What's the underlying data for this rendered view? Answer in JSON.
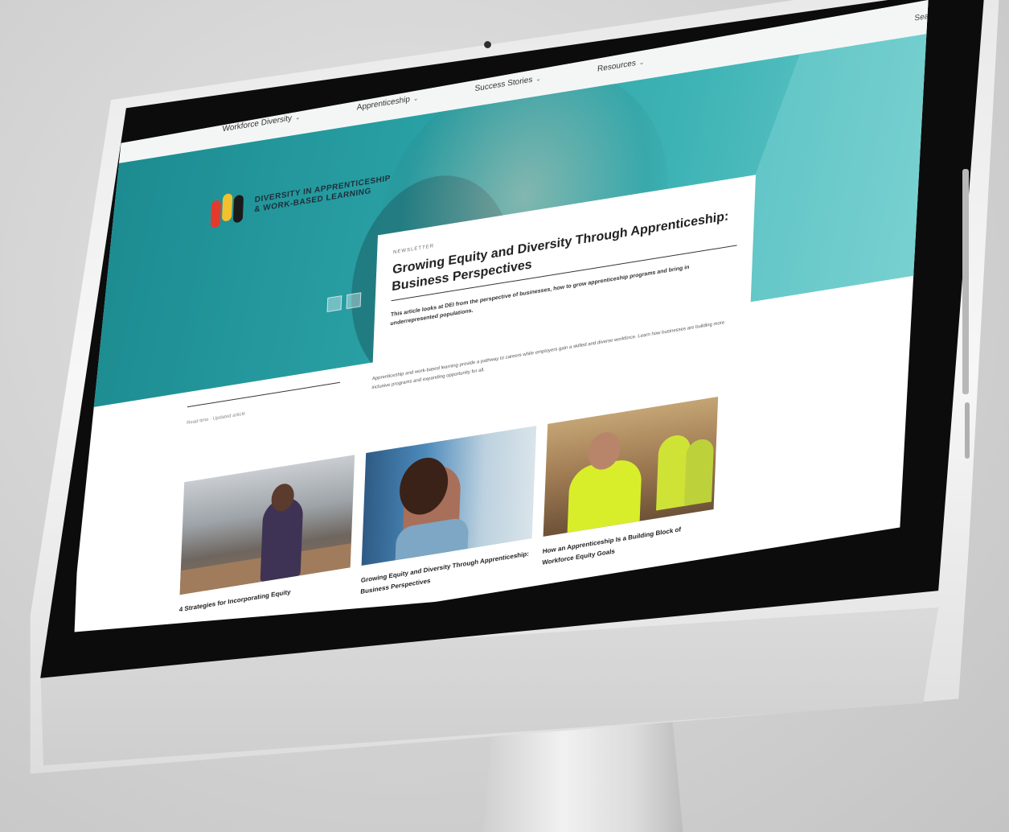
{
  "nav": {
    "items": [
      {
        "label": "Workforce Diversity",
        "icon": "chevron-down-icon"
      },
      {
        "label": "Apprenticeship",
        "icon": "chevron-down-icon"
      },
      {
        "label": "Success Stories",
        "icon": "chevron-down-icon"
      },
      {
        "label": "Resources",
        "icon": "chevron-down-icon"
      }
    ],
    "search_label": "Search Site",
    "search_icon": "search-icon"
  },
  "logo": {
    "line1": "Diversity in Apprenticeship",
    "line2": "& Work-Based Learning"
  },
  "feature": {
    "kicker": "Newsletter",
    "title": "Growing Equity and Diversity Through Apprenticeship: Business Perspectives",
    "summary": "This article looks at DEI from the perspective of businesses, how to grow apprenticeship programs and bring in underrepresented populations."
  },
  "body": {
    "meta": "Read time · Updated article",
    "paragraph": "Apprenticeship and work-based learning provide a pathway to careers while employers gain a skilled and diverse workforce. Learn how businesses are building more inclusive programs and expanding opportunity for all."
  },
  "cards": [
    {
      "caption": "4 Strategies for Incorporating Equity",
      "image": "woman-office-laptop-photo"
    },
    {
      "caption": "Growing Equity and Diversity Through Apprenticeship: Business Perspectives",
      "image": "woman-portrait-photo"
    },
    {
      "caption": "How an Apprenticeship Is a Building Block of Workforce Equity Goals",
      "image": "construction-workers-photo"
    }
  ],
  "colors": {
    "hero_teal": "#2ba3a7",
    "logo_red": "#e23b2e",
    "logo_yellow": "#f2c12e",
    "logo_black": "#1a1a1a"
  }
}
